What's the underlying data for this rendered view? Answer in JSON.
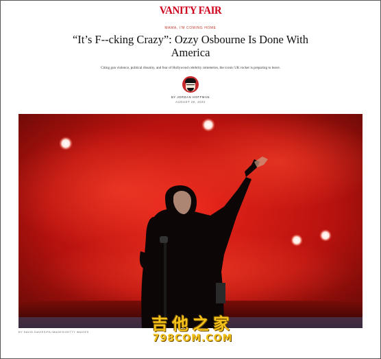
{
  "site": {
    "logo": "VANITY FAIR"
  },
  "article": {
    "rubric": "MAMA, I'M COMING HOME",
    "headline": "“It’s F--cking Crazy”: Ozzy Osbourne Is Done With America",
    "dek": "Citing gun violence, political disunity, and fear of Hollywood celebrity cemeteries, the iconic UK rocker is preparing to leave.",
    "byline": "BY JORDAN HOFFMAN",
    "date": "AUGUST 26, 2022",
    "photo_credit": "BY DAVID DAVIES/PA IMAGES/GETTY IMAGES"
  },
  "watermark": {
    "cn": "吉他之家",
    "en": "798COM.COM"
  },
  "colors": {
    "brand": "#d0021b",
    "stage_red": "#c4140f"
  }
}
